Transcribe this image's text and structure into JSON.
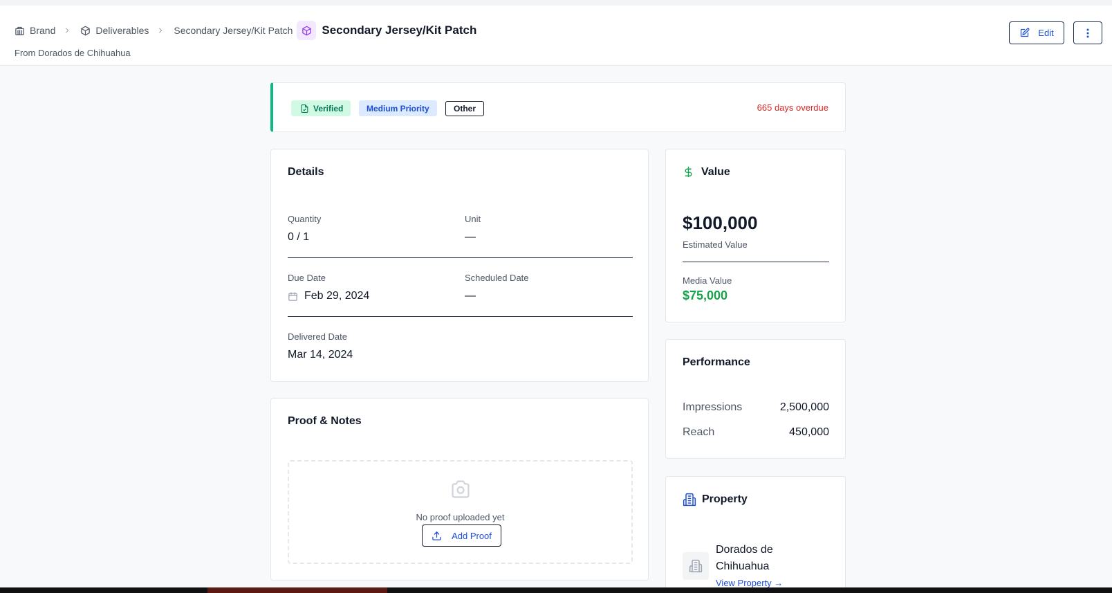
{
  "breadcrumb": {
    "brand": "Brand",
    "deliverables": "Deliverables",
    "current": "Secondary Jersey/Kit Patch"
  },
  "header": {
    "title": "Secondary Jersey/Kit Patch",
    "subtitle": "From Dorados de Chihuahua",
    "edit_label": "Edit"
  },
  "status": {
    "verified": "Verified",
    "priority": "Medium Priority",
    "type": "Other",
    "overdue": "665 days overdue"
  },
  "details": {
    "title": "Details",
    "quantity_label": "Quantity",
    "quantity_value": "0 / 1",
    "unit_label": "Unit",
    "unit_value": "—",
    "due_label": "Due Date",
    "due_value": "Feb 29, 2024",
    "scheduled_label": "Scheduled Date",
    "scheduled_value": "—",
    "delivered_label": "Delivered Date",
    "delivered_value": "Mar 14, 2024"
  },
  "proof": {
    "title": "Proof & Notes",
    "empty_text": "No proof uploaded yet",
    "add_label": "Add Proof"
  },
  "value": {
    "title": "Value",
    "estimated_amount": "$100,000",
    "estimated_label": "Estimated Value",
    "media_label": "Media Value",
    "media_amount": "$75,000"
  },
  "performance": {
    "title": "Performance",
    "impressions_label": "Impressions",
    "impressions_value": "2,500,000",
    "reach_label": "Reach",
    "reach_value": "450,000"
  },
  "property": {
    "title": "Property",
    "name": "Dorados de Chihuahua",
    "link": "View Property →"
  },
  "colors": {
    "accent": "#1d4ed8",
    "success": "#16a34a",
    "danger": "#dc2626",
    "verified_bg": "#d1fae5",
    "priority_bg": "#dbeafe",
    "status_border": "#10b981"
  }
}
